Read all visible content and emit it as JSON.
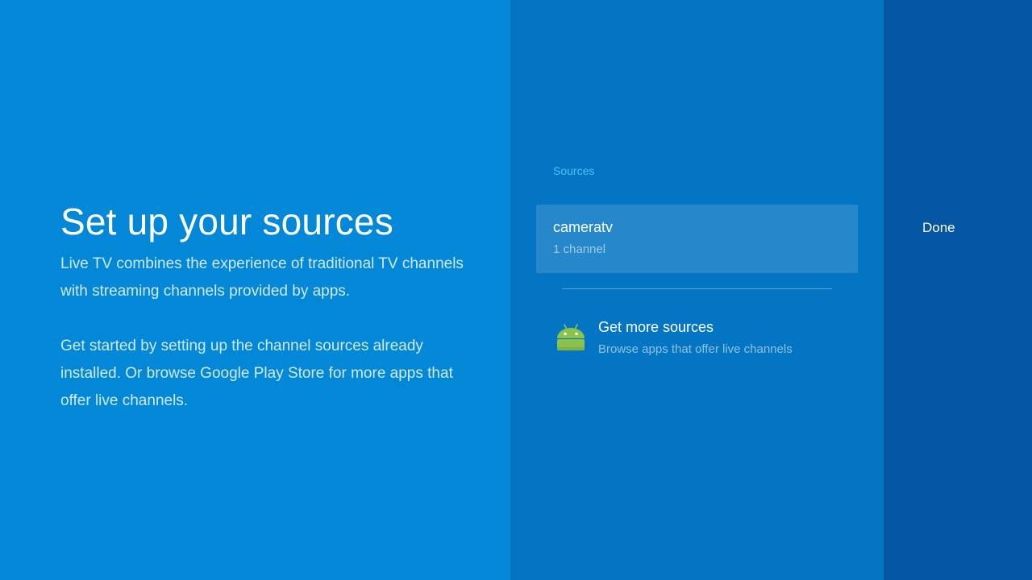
{
  "intro": {
    "title": "Set up your sources",
    "paragraph1": "Live TV combines the experience of traditional TV channels with streaming channels provided by apps.",
    "paragraph2": "Get started by setting up the channel sources already installed. Or browse Google Play Store for more apps that offer live channels."
  },
  "sources": {
    "header": "Sources",
    "items": [
      {
        "name": "cameratv",
        "subtitle": "1 channel"
      }
    ],
    "more": {
      "icon": "android-icon",
      "title": "Get more sources",
      "subtitle": "Browse apps that offer live channels"
    }
  },
  "actions": {
    "done_label": "Done"
  },
  "colors": {
    "left_bg": "#0288d6",
    "middle_bg": "#0375c3",
    "right_bg": "#0356a1",
    "accent": "#4fc3f7",
    "android_green": "#8bc34a"
  }
}
